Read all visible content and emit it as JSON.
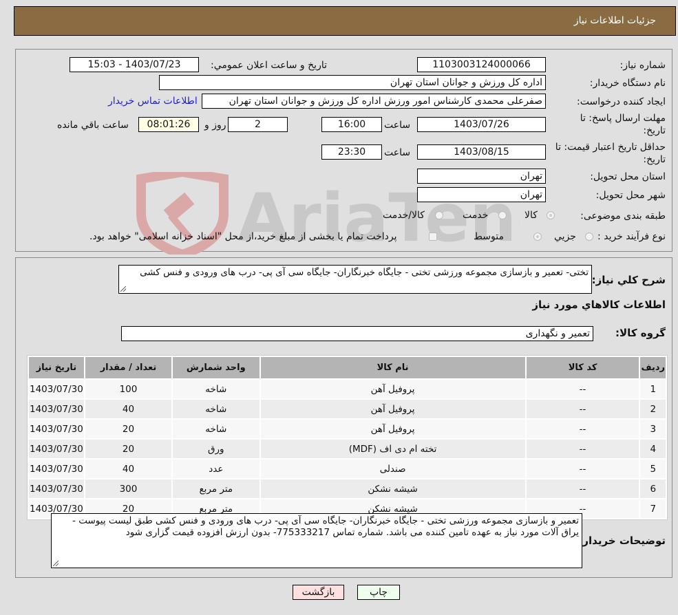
{
  "header": {
    "title": "جزئیات اطلاعات نیاز"
  },
  "form": {
    "need_number": {
      "label": "شماره نیاز:",
      "value": "1103003124000066"
    },
    "announce_datetime": {
      "label": "تاریخ و ساعت اعلان عمومي:",
      "value": "1403/07/23 - 15:03"
    },
    "buyer_org": {
      "label": "نام دستگاه خریدار:",
      "value": "اداره کل ورزش و جوانان استان تهران"
    },
    "requester": {
      "label": "ایجاد کننده درخواست:",
      "value": "صفرعلی محمدی کارشناس امور ورزش اداره کل ورزش و جوانان استان تهران"
    },
    "buyer_contact_link": "اطلاعات تماس خریدار",
    "reply_deadline": {
      "label_line1": "مهلت ارسال پاسخ: تا",
      "label_line2": "تاریخ:",
      "date": "1403/07/26",
      "time_label": "ساعت",
      "time": "16:00",
      "days": "2",
      "days_label": "روز و",
      "remaining": "08:01:26",
      "remaining_label": "ساعت باقي مانده"
    },
    "price_validity": {
      "label_line1": "حداقل تاریخ اعتبار قیمت: تا",
      "label_line2": "تاریخ:",
      "date": "1403/08/15",
      "time_label": "ساعت",
      "time": "23:30"
    },
    "delivery_province": {
      "label": "استان محل تحویل:",
      "value": "تهران"
    },
    "delivery_city": {
      "label": "شهر محل تحویل:",
      "value": "تهران"
    },
    "category": {
      "label": "طبقه بندی موضوعی:",
      "options": [
        "کالا",
        "خدمت",
        "کالا/خدمت"
      ],
      "selected": "کالا"
    },
    "purchase_process": {
      "label": "نوع فرآیند خرید :",
      "options": [
        "جزيي",
        "متوسط"
      ],
      "selected": "متوسط",
      "treasury_note": "پرداخت تمام یا بخشی از مبلغ خرید،از محل \"اسناد خزانه اسلامی\" خواهد بود."
    }
  },
  "details": {
    "general_desc_label": "شرح کلي نياز:",
    "general_desc": "تختی- تعمیر و بازسازی مجموعه ورزشی تختی - جایگاه خبرنگاران- جایگاه سی آی پی- درب های ورودی و فنس کشی",
    "goods_info_title": "اطلاعات کالاهاي مورد نياز",
    "goods_group_label": "گروه کالا:",
    "goods_group": "تعمیر و نگهداری",
    "table": {
      "headers": [
        "رديف",
        "کد کالا",
        "نام کالا",
        "واحد شمارش",
        "تعداد / مقدار",
        "تاریخ نیاز"
      ],
      "rows": [
        [
          "1",
          "--",
          "پروفیل آهن",
          "شاخه",
          "100",
          "1403/07/30"
        ],
        [
          "2",
          "--",
          "پروفیل آهن",
          "شاخه",
          "40",
          "1403/07/30"
        ],
        [
          "3",
          "--",
          "پروفیل آهن",
          "شاخه",
          "20",
          "1403/07/30"
        ],
        [
          "4",
          "--",
          "تخته ام دی اف (MDF)",
          "ورق",
          "20",
          "1403/07/30"
        ],
        [
          "5",
          "--",
          "صندلی",
          "عدد",
          "40",
          "1403/07/30"
        ],
        [
          "6",
          "--",
          "شیشه نشکن",
          "متر مربع",
          "300",
          "1403/07/30"
        ],
        [
          "7",
          "--",
          "شیشه نشکن",
          "متر مربع",
          "20",
          "1403/07/30"
        ]
      ]
    },
    "buyer_notes_label": "توضیحات خریدار:",
    "buyer_notes": "تعمیر و بازسازی مجموعه ورزشی تختی - جایگاه خبرنگاران- جایگاه سی آی پی- درب های ورودی و فنس کشی طبق لیست پیوست - یراق آلات مورد نیاز به عهده تامین کننده می باشد. شماره تماس 775333217- بدون ارزش افزوده قیمت گزاری شود"
  },
  "buttons": {
    "print": "چاپ",
    "back": "بازگشت"
  },
  "watermark": {
    "text": "AriaTender.neT"
  },
  "colors": {
    "header_bg": "#8b6c42",
    "link": "#2222cc",
    "print_bg": "#eeffee",
    "back_bg": "#ffe0e0"
  }
}
